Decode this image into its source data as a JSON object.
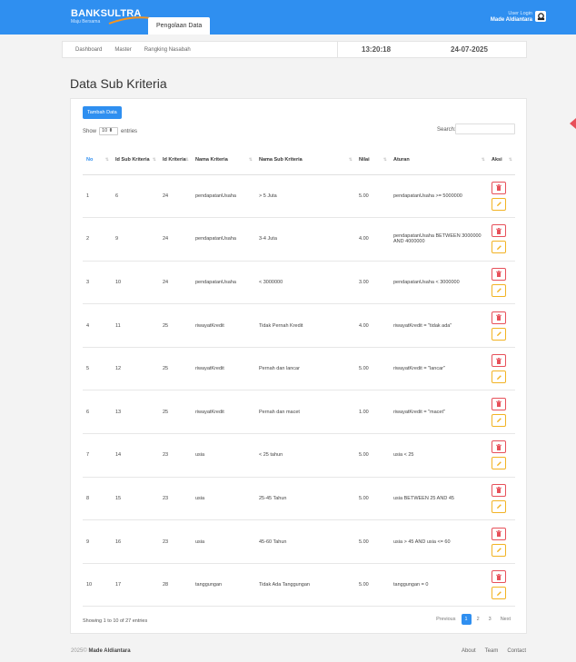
{
  "header": {
    "logo_text_1": "BANK",
    "logo_text_2": "SULTRA",
    "logo_tagline": "Maju Bersama",
    "active_tab": "Pengolaan Data",
    "user_label": "User Login",
    "user_name": "Made Aldiantara",
    "user_icon": "user-icon"
  },
  "subnav": {
    "items": [
      "Dashboard",
      "Master",
      "Rangking Nasabah"
    ],
    "time": "13:20:18",
    "date": "24-07-2025"
  },
  "page_title": "Data Sub Kriteria",
  "toolbar": {
    "add_label": "Tambah Data",
    "show_label": "Show",
    "entries_value": "10",
    "entries_label": "entries",
    "search_label": "Search:"
  },
  "table": {
    "headers": [
      "No",
      "Id Sub Kriteria",
      "Id Kriteria",
      "Nama Kriteria",
      "Nama Sub Kriteria",
      "Nilai",
      "Aturan",
      "Aksi"
    ],
    "rows": [
      {
        "no": "1",
        "id_sub": "6",
        "id_kriteria": "24",
        "nama_kriteria": "pendapatanUsaha",
        "nama_sub": "> 5 Juta",
        "nilai": "5.00",
        "aturan": "pendapatanUsaha >= 5000000"
      },
      {
        "no": "2",
        "id_sub": "9",
        "id_kriteria": "24",
        "nama_kriteria": "pendapatanUsaha",
        "nama_sub": "3-4 Juta",
        "nilai": "4.00",
        "aturan": "pendapatanUsaha BETWEEN 3000000 AND 4000000"
      },
      {
        "no": "3",
        "id_sub": "10",
        "id_kriteria": "24",
        "nama_kriteria": "pendapatanUsaha",
        "nama_sub": "< 3000000",
        "nilai": "3.00",
        "aturan": "pendapatanUsaha < 3000000"
      },
      {
        "no": "4",
        "id_sub": "11",
        "id_kriteria": "25",
        "nama_kriteria": "riwayatKredit",
        "nama_sub": "Tidak Pernah Kredit",
        "nilai": "4.00",
        "aturan": "riwayatKredit = \"tidak ada\""
      },
      {
        "no": "5",
        "id_sub": "12",
        "id_kriteria": "25",
        "nama_kriteria": "riwayatKredit",
        "nama_sub": "Pernah dan lancar",
        "nilai": "5.00",
        "aturan": "riwayatKredit = \"lancar\""
      },
      {
        "no": "6",
        "id_sub": "13",
        "id_kriteria": "25",
        "nama_kriteria": "riwayatKredit",
        "nama_sub": "Pernah dan macet",
        "nilai": "1.00",
        "aturan": "riwayatKredit = \"macet\""
      },
      {
        "no": "7",
        "id_sub": "14",
        "id_kriteria": "23",
        "nama_kriteria": "usia",
        "nama_sub": "< 25 tahun",
        "nilai": "5.00",
        "aturan": "usia < 25"
      },
      {
        "no": "8",
        "id_sub": "15",
        "id_kriteria": "23",
        "nama_kriteria": "usia",
        "nama_sub": "25-45 Tahun",
        "nilai": "5.00",
        "aturan": "usia BETWEEN 25 AND 45"
      },
      {
        "no": "9",
        "id_sub": "16",
        "id_kriteria": "23",
        "nama_kriteria": "usia",
        "nama_sub": "45-60 Tahun",
        "nilai": "5.00",
        "aturan": "usia > 45 AND usia <= 60"
      },
      {
        "no": "10",
        "id_sub": "17",
        "id_kriteria": "28",
        "nama_kriteria": "tanggungan",
        "nama_sub": "Tidak Ada Tanggungan",
        "nilai": "5.00",
        "aturan": "tanggungan = 0"
      }
    ],
    "delete_icon": "trash-icon",
    "edit_icon": "pencil-icon"
  },
  "footer_table": {
    "showing": "Showing 1 to 10 of 27 entries",
    "previous": "Previous",
    "pages": [
      "1",
      "2",
      "3"
    ],
    "next": "Next"
  },
  "footer": {
    "copyright": "2025©",
    "author": "Made Aldiantara",
    "links": [
      "About",
      "Team",
      "Contact"
    ]
  },
  "colors": {
    "brand": "#2f8ff0",
    "delete": "#e7505a",
    "edit": "#f2b324"
  }
}
